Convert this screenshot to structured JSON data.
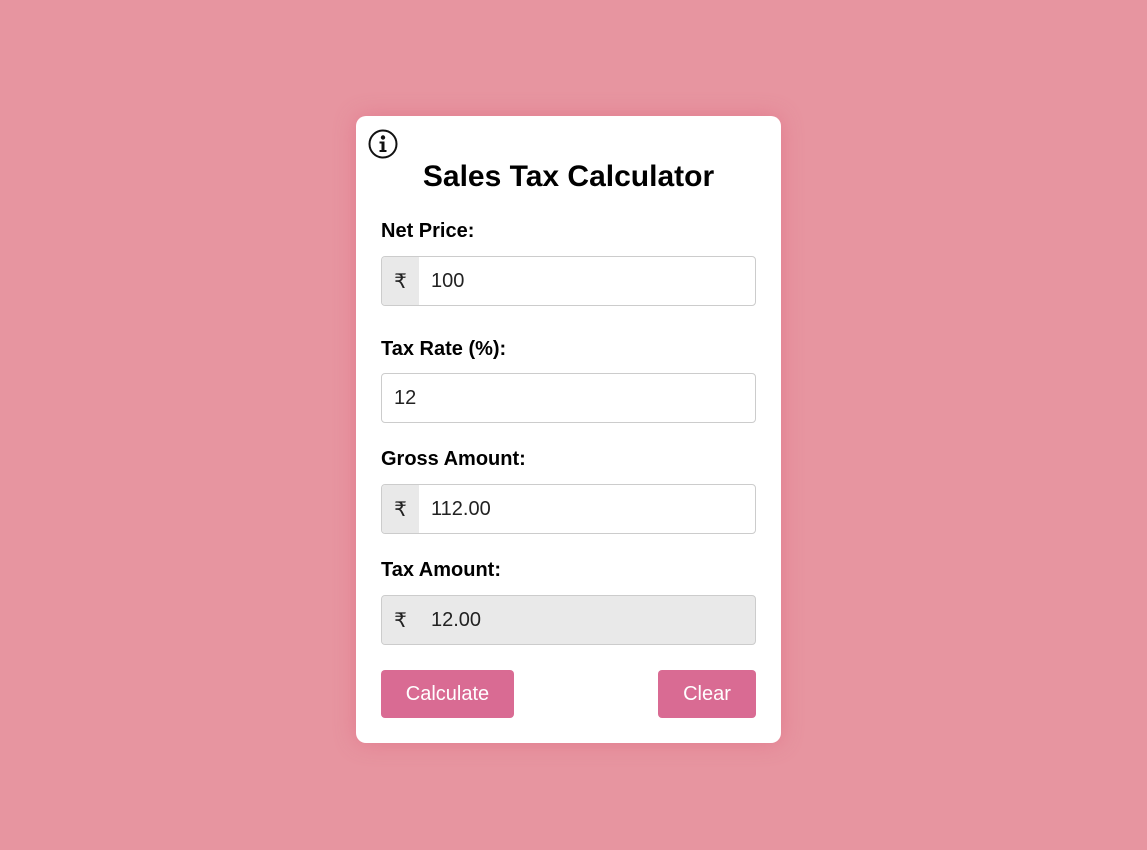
{
  "app": {
    "title": "Sales Tax Calculator",
    "info_icon": "info-icon"
  },
  "colors": {
    "background": "#e795a0",
    "card": "#ffffff",
    "button": "#d96b93",
    "readonly_field": "#e9e9e9"
  },
  "fields": {
    "net_price": {
      "label": "Net Price:",
      "prefix": "₹",
      "value": "100"
    },
    "tax_rate": {
      "label": "Tax Rate (%):",
      "value": "12"
    },
    "gross_amount": {
      "label": "Gross Amount:",
      "prefix": "₹",
      "value": "112.00"
    },
    "tax_amount": {
      "label": "Tax Amount:",
      "prefix": "₹",
      "value": "12.00"
    }
  },
  "buttons": {
    "calculate": "Calculate",
    "clear": "Clear"
  }
}
